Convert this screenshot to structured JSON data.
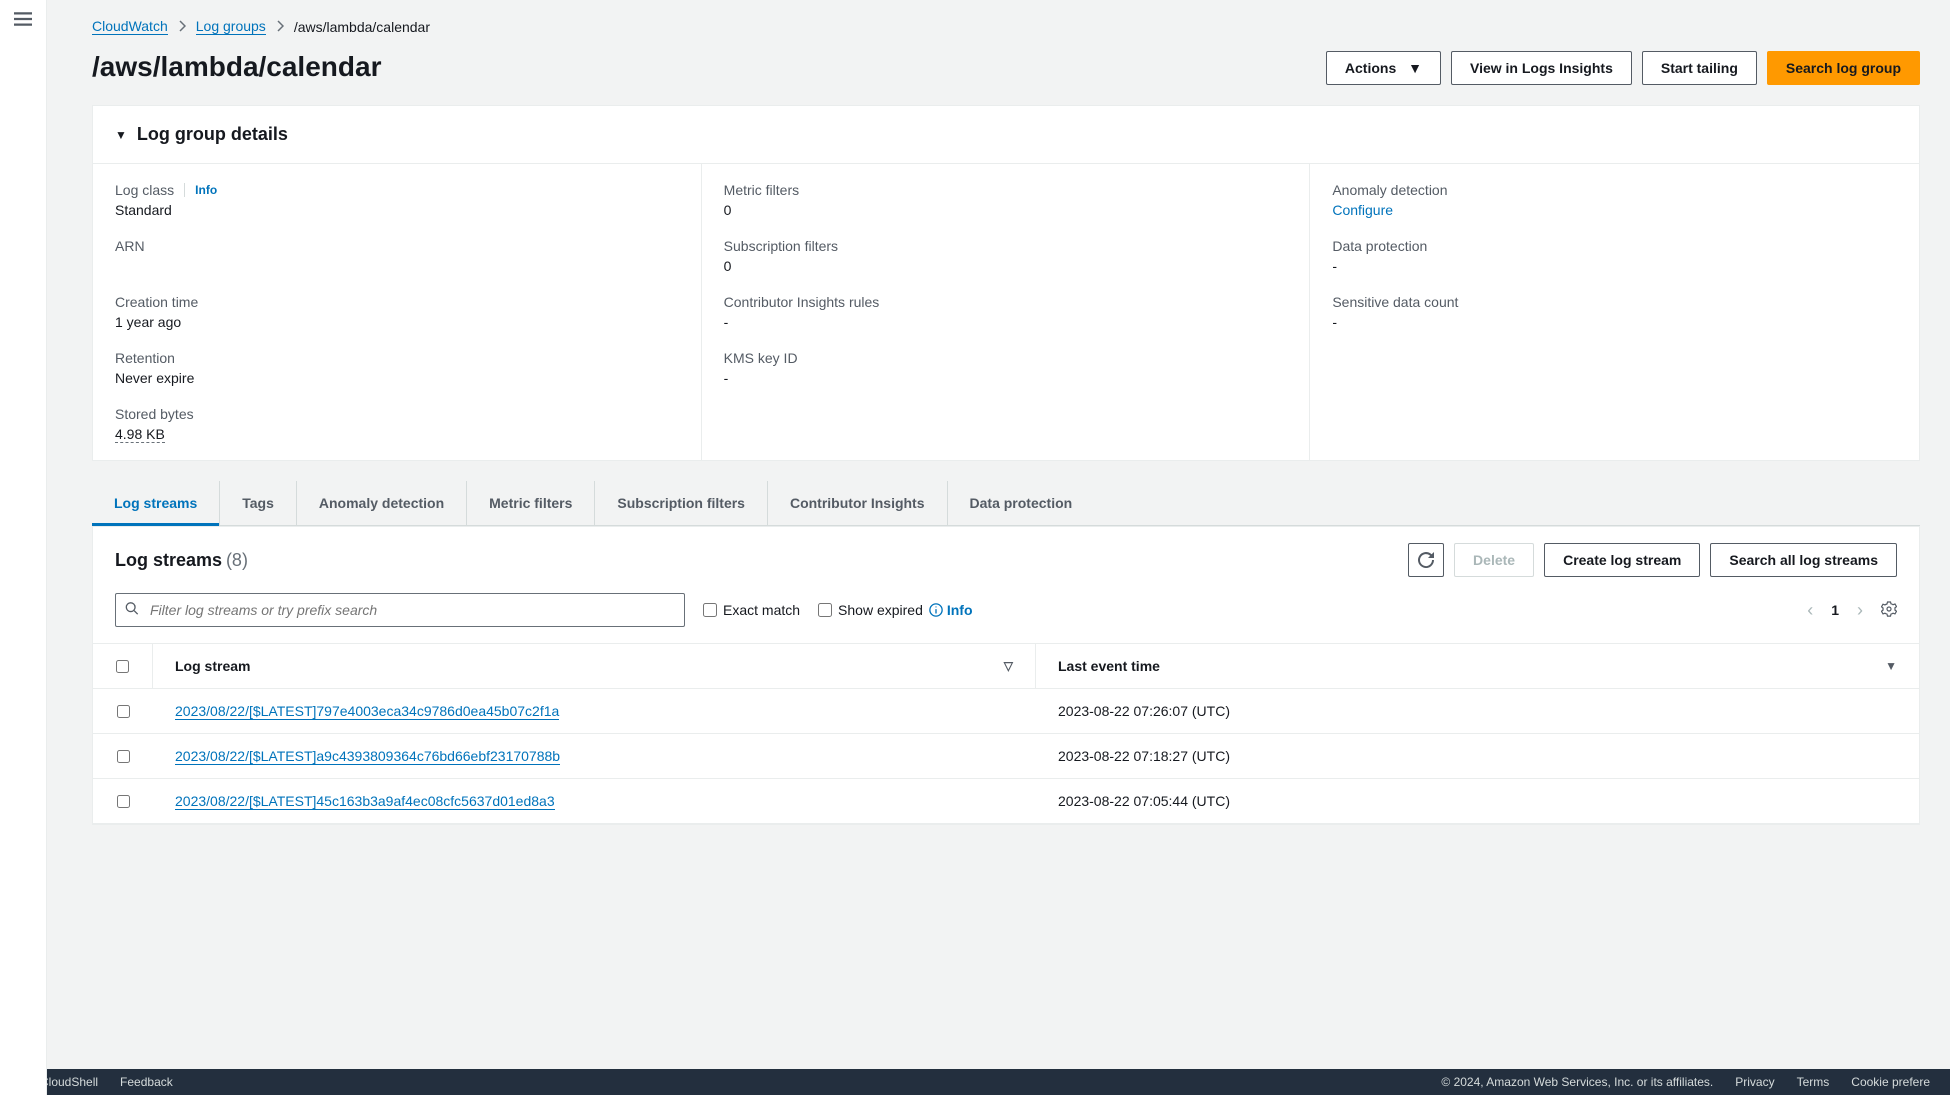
{
  "breadcrumb": {
    "root": "CloudWatch",
    "group": "Log groups",
    "current": "/aws/lambda/calendar"
  },
  "title": "/aws/lambda/calendar",
  "actions": {
    "actions": "Actions",
    "insights": "View in Logs Insights",
    "tailing": "Start tailing",
    "search": "Search log group"
  },
  "details": {
    "header": "Log group details",
    "col1": {
      "log_class_label": "Log class",
      "log_class_info": "Info",
      "log_class_value": "Standard",
      "arn_label": "ARN",
      "arn_value": "",
      "creation_label": "Creation time",
      "creation_value": "1 year ago",
      "retention_label": "Retention",
      "retention_value": "Never expire",
      "stored_label": "Stored bytes",
      "stored_value": "4.98 KB"
    },
    "col2": {
      "metric_label": "Metric filters",
      "metric_value": "0",
      "sub_label": "Subscription filters",
      "sub_value": "0",
      "ci_label": "Contributor Insights rules",
      "ci_value": "-",
      "kms_label": "KMS key ID",
      "kms_value": "-"
    },
    "col3": {
      "anomaly_label": "Anomaly detection",
      "anomaly_value": "Configure",
      "dp_label": "Data protection",
      "dp_value": "-",
      "sensitive_label": "Sensitive data count",
      "sensitive_value": "-"
    }
  },
  "tabs": [
    "Log streams",
    "Tags",
    "Anomaly detection",
    "Metric filters",
    "Subscription filters",
    "Contributor Insights",
    "Data protection"
  ],
  "streams": {
    "title": "Log streams",
    "count": "(8)",
    "btn_delete": "Delete",
    "btn_create": "Create log stream",
    "btn_search": "Search all log streams",
    "search_placeholder": "Filter log streams or try prefix search",
    "exact_match": "Exact match",
    "show_expired": "Show expired",
    "info": "Info",
    "page": "1",
    "col_stream": "Log stream",
    "col_time": "Last event time",
    "rows": [
      {
        "stream": "2023/08/22/[$LATEST]797e4003eca34c9786d0ea45b07c2f1a",
        "time": "2023-08-22 07:26:07 (UTC)"
      },
      {
        "stream": "2023/08/22/[$LATEST]a9c4393809364c76bd66ebf23170788b",
        "time": "2023-08-22 07:18:27 (UTC)"
      },
      {
        "stream": "2023/08/22/[$LATEST]45c163b3a9af4ec08cfc5637d01ed8a3",
        "time": "2023-08-22 07:05:44 (UTC)"
      }
    ]
  },
  "footer": {
    "cloudshell": "CloudShell",
    "feedback": "Feedback",
    "copyright": "© 2024, Amazon Web Services, Inc. or its affiliates.",
    "privacy": "Privacy",
    "terms": "Terms",
    "cookie": "Cookie prefere"
  }
}
